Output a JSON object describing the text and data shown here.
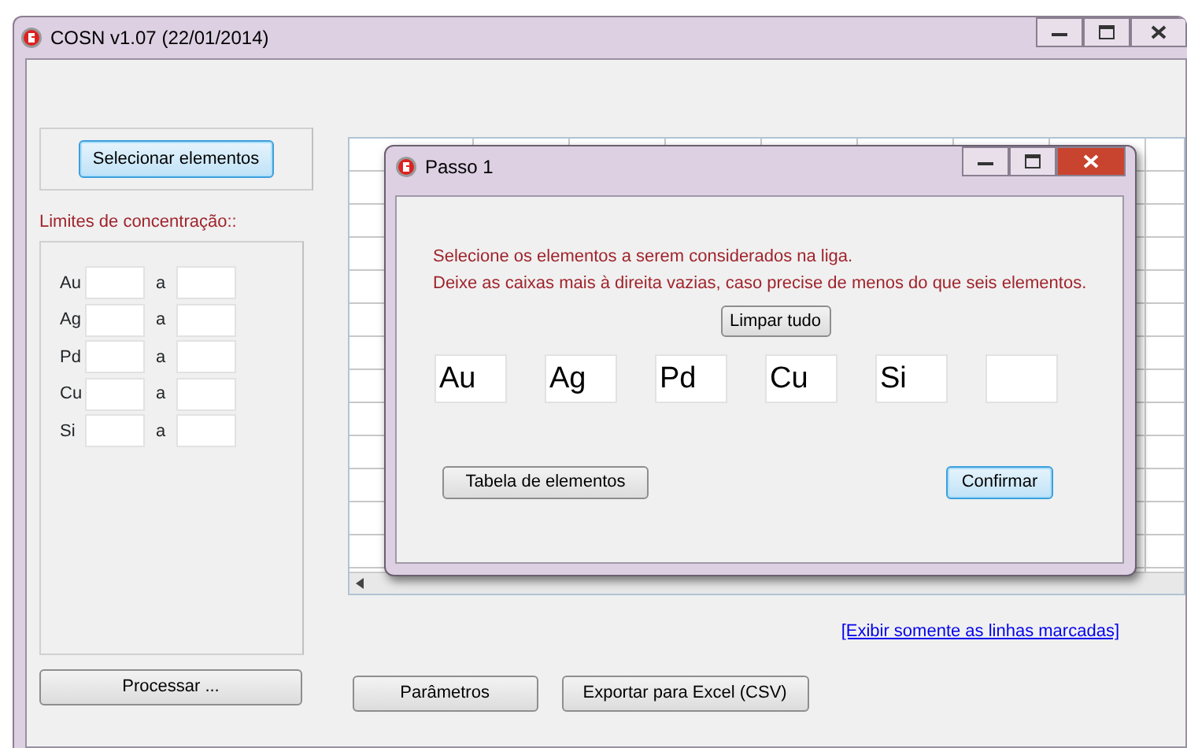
{
  "main_window": {
    "title": "COSN v1.07 (22/01/2014)"
  },
  "left_panel": {
    "select_button": {
      "label": "Selecionar elementos",
      "highlighted": true
    },
    "limits_label": "Limites de concentração::",
    "limits": [
      {
        "element": "Au",
        "separator": "a"
      },
      {
        "element": "Ag",
        "separator": "a"
      },
      {
        "element": "Pd",
        "separator": "a"
      },
      {
        "element": "Cu",
        "separator": "a"
      },
      {
        "element": "Si",
        "separator": "a"
      }
    ],
    "process_button": "Processar ..."
  },
  "results": {
    "link": "[Exibir somente as linhas marcadas]",
    "buttons": [
      "Parâmetros",
      "Exportar para Excel (CSV)"
    ]
  },
  "dialog": {
    "title": "Passo 1",
    "instructions": [
      "Selecione os elementos a serem considerados na liga.",
      "Deixe as caixas mais à direita vazias, caso precise de menos do que seis elementos."
    ],
    "clear_button": "Limpar tudo",
    "element_fields": [
      {
        "kind": "filled",
        "value": "Au"
      },
      {
        "kind": "filled",
        "value": "Ag"
      },
      {
        "kind": "filled",
        "value": "Pd"
      },
      {
        "kind": "filled",
        "value": "Cu"
      },
      {
        "kind": "filled",
        "value": "Si"
      },
      {
        "kind": "empty"
      }
    ],
    "table_button": "Tabela de elementos",
    "confirm_button": {
      "label": "Confirmar",
      "focused": true
    }
  }
}
